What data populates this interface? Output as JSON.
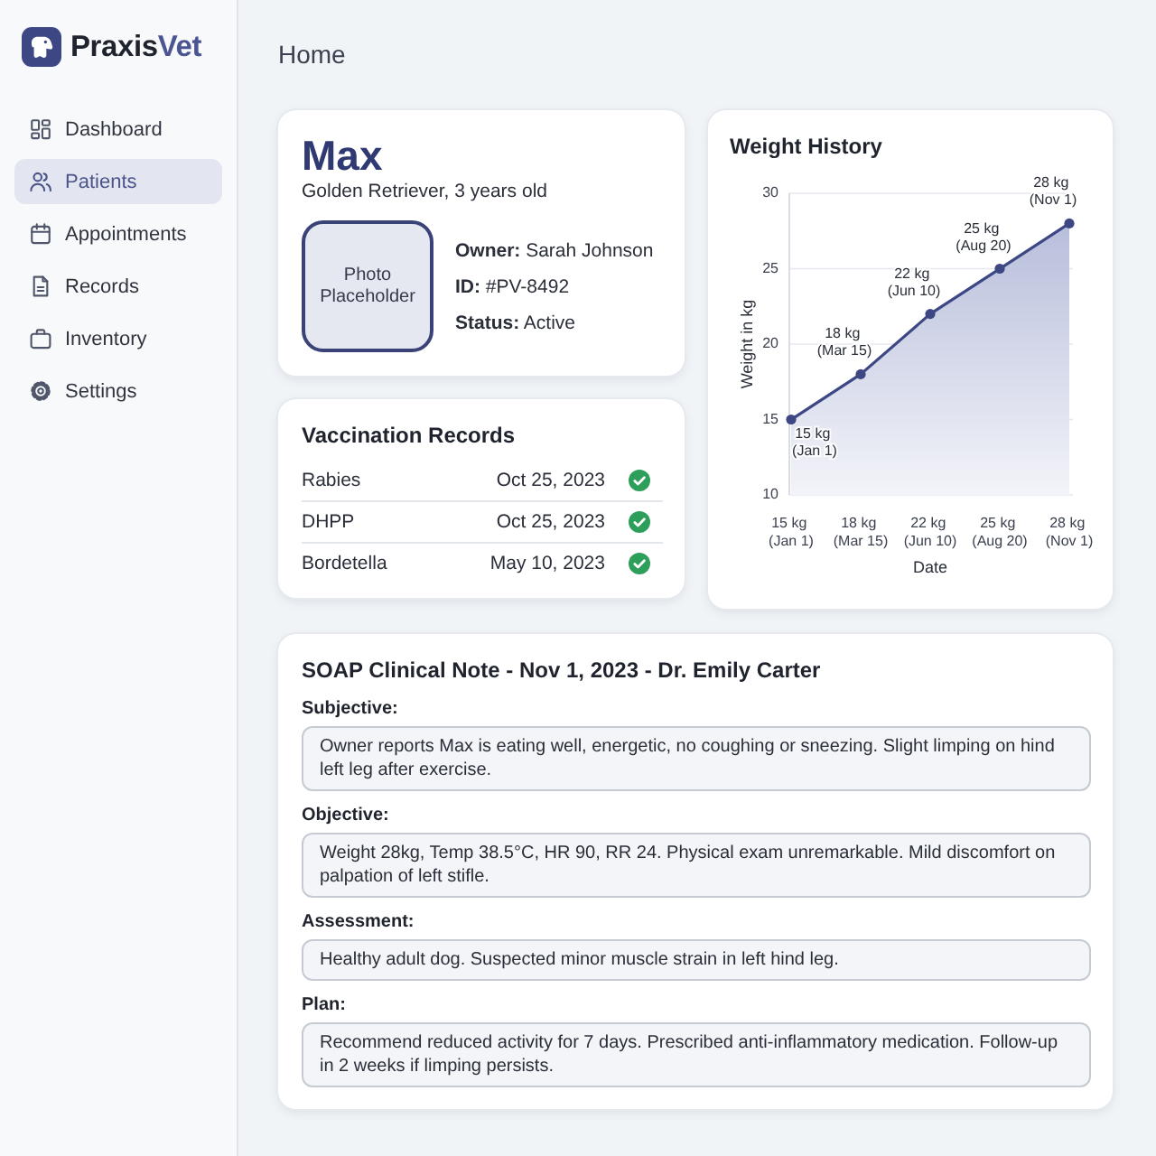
{
  "sidebar": {
    "brand": "**Praxis**Vet",
    "items": [
      {
        "label": "Dashboard",
        "selected": false
      },
      {
        "label": "Patients",
        "selected": true
      },
      {
        "label": "Appointments",
        "selected": false
      },
      {
        "label": "Records",
        "selected": false
      },
      {
        "label": "Inventory",
        "selected": false
      },
      {
        "label": "Settings",
        "selected": false
      }
    ]
  },
  "header": {
    "title": "Home"
  },
  "patient": {
    "name": "Max",
    "description": "Golden Retriever, 3 years old",
    "photo": "Photo Placeholder",
    "details": [
      "**Owner:** Sarah Johnson",
      "**ID:** #PV-8492",
      "**Status:** Active"
    ]
  },
  "vaccinations": {
    "title": "Vaccination Records",
    "rows": [
      {
        "name": "Rabies",
        "date": "Oct 25, 2023",
        "completed": true
      },
      {
        "name": "DHPP",
        "date": "Oct 25, 2023",
        "completed": true
      },
      {
        "name": "Bordetella",
        "date": "May 10, 2023",
        "completed": true
      }
    ]
  },
  "weight_history": {
    "title": "Weight History",
    "chart_data": {
      "type": "area",
      "xlabel": "Date",
      "ylabel": "Weight in kg",
      "categories": [
        "15 kg (Jan 1)",
        "18 kg (Mar 15)",
        "22 kg (Jun 10)",
        "25 kg (Aug 20)",
        "28 kg (Nov 1)"
      ],
      "values": [
        15,
        18,
        22,
        25,
        28
      ],
      "ylim": [
        10,
        30
      ],
      "yticks": [
        10,
        15,
        20,
        25,
        30
      ],
      "grid": true,
      "value_labels": [
        "15 kg (Jan 1)",
        "18 kg (Mar 15)",
        "22 kg (Jun 10)",
        "25 kg (Aug 20)",
        "28 kg (Nov 1)"
      ]
    }
  },
  "soap_note": {
    "title": "SOAP Clinical Note - Nov 1, 2023 - Dr. Emily Carter",
    "sections": [
      {
        "label": "Subjective:",
        "text": "Owner reports Max is eating well, energetic, no coughing or sneezing. Slight limping on hind left leg after exercise."
      },
      {
        "label": "Objective:",
        "text": "Weight 28kg, Temp 38.5°C, HR 90, RR 24. Physical exam unremarkable. Mild discomfort on palpation of left stifle."
      },
      {
        "label": "Assessment:",
        "text": "Healthy adult dog. Suspected minor muscle strain in left hind leg."
      },
      {
        "label": "Plan:",
        "text": "Recommend reduced activity for 7 days. Prescribed anti-inflammatory medication. Follow-up in 2 weeks if limping persists."
      }
    ]
  }
}
